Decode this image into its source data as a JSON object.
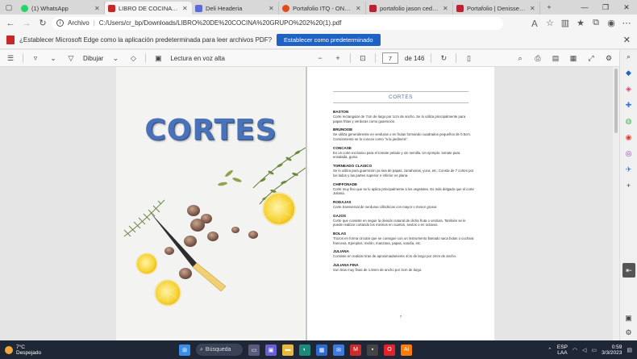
{
  "browser": {
    "tabs": [
      {
        "label": "(1) WhatsApp",
        "icon": "whatsapp-icon",
        "active": false
      },
      {
        "label": "LIBRO DE COCINA GRUPO",
        "icon": "pdf-icon",
        "active": true
      },
      {
        "label": "Deli Headeria",
        "icon": "deli-icon",
        "active": false
      },
      {
        "label": "Portafolio ITQ - ONE DAY b",
        "icon": "portfolio-icon",
        "active": false
      },
      {
        "label": "portafolio jason cedeño by",
        "icon": "video-icon",
        "active": false
      },
      {
        "label": "Portafolio | Denisse Alejand",
        "icon": "video-icon",
        "active": false
      }
    ],
    "address": {
      "label": "Archivo",
      "url": "C:/Users/cr_bp/Downloads/LIBRO%20DE%20COCINA%20GRUPO%202%20(1).pdf"
    }
  },
  "infobar": {
    "message": "¿Establecer Microsoft Edge como la aplicación predeterminada para leer archivos PDF?",
    "button": "Establecer como predeterminado"
  },
  "pdf_toolbar": {
    "draw_label": "Dibujar",
    "read_aloud_label": "Lectura en voz alta",
    "current_page": "7",
    "total_pages": "de 146"
  },
  "cover": {
    "title": "CORTES"
  },
  "page": {
    "title": "CORTES",
    "sections": [
      {
        "heading": "BASTON",
        "body": "Corte rectangular de 7cm de largo por 1cm de ancho. Se lo utiliza principalmente para papas fritas y verduras como guarnición."
      },
      {
        "heading": "BRUNOISE",
        "body": "Se utiliza generalmente en verduras o en frutas formando cuadrados pequeños de 0.5cm. Comúnmente se lo conoce como \"a la jardinera\"."
      },
      {
        "heading": "CONCASE",
        "body": "Es un corte exclusivo para el tomate pelado y sin semilla. Un ejemplo: tomate para ensalada, guiso."
      },
      {
        "heading": "TORNEADO CLASICO",
        "body": "Se lo utiliza para guarnición ya sea de papas, zanahorias, yuca, etc. Consta de 7 cortes por los lados y las partes superior e inferior es plana."
      },
      {
        "heading": "CHIFFONADE",
        "body": "Corte muy fino que se lo aplica principalmente a los vegetales. Es más delgado que el corte Juliana."
      },
      {
        "heading": "RODAJAS",
        "body": "Corte transversal de verduras cilíndricas con mayor o menor grosor."
      },
      {
        "heading": "GAJOS",
        "body": "Corte que consiste en seguir la división natural de dicha fruta o verdura. También se le puede realizar cortando los mismos en cuartos, sextos o en octavos."
      },
      {
        "heading": "BOLAS",
        "body": "Trozos en forma circular que se consigue con un instrumento llamado saca bolas o cuchara francesa. Ejemplos: melón, manzana, papas, sandía, etc."
      },
      {
        "heading": "JULIANA",
        "body": "Consiste en realizar tiras de aproximadamente 4cm de largo por 2mm de ancho."
      },
      {
        "heading": "JULIANA FINA",
        "body": "Son tiras muy finas de 1.5mm de ancho por 3cm de largo."
      }
    ],
    "page_number": "7"
  },
  "taskbar": {
    "temperature": "7°C",
    "weather": "Despejado",
    "search_label": "Búsqueda",
    "lang_top": "ESP",
    "lang_bottom": "LAA",
    "time": "0:59",
    "date": "3/3/2023"
  }
}
